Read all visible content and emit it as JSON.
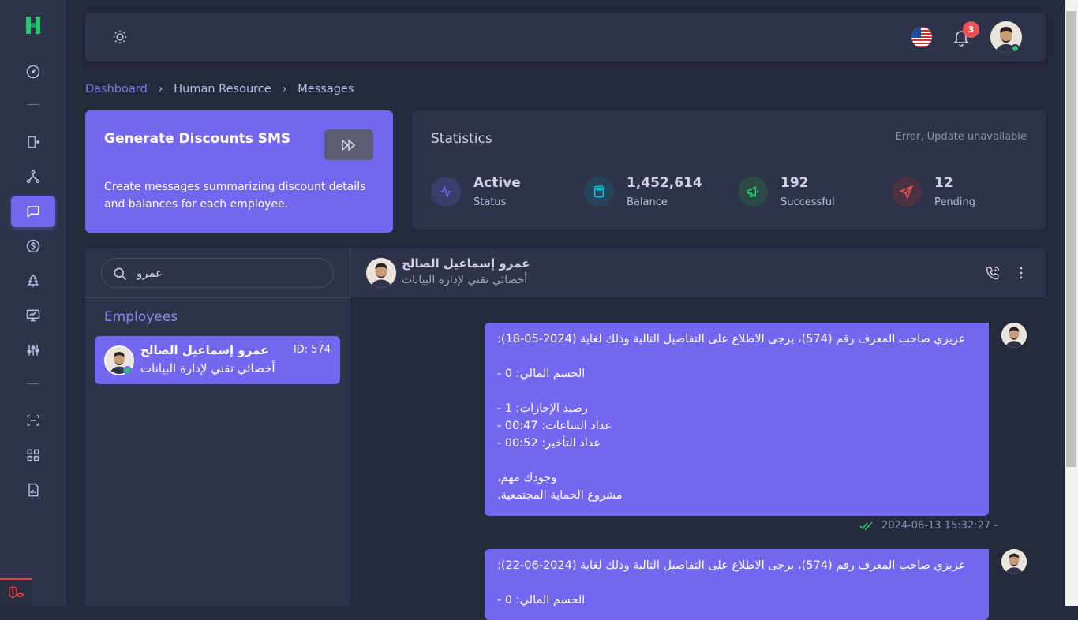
{
  "navbar": {
    "notification_count": "3"
  },
  "breadcrumb": {
    "items": [
      "Dashboard",
      "Human Resource",
      "Messages"
    ]
  },
  "generate_card": {
    "title": "Generate Discounts SMS",
    "description": "Create messages summarizing discount details and balances for each employee."
  },
  "statistics": {
    "title": "Statistics",
    "note": "Error, Update unavailable",
    "items": [
      {
        "value": "Active",
        "label": "Status",
        "icon": "activity-icon",
        "color": "#7367f0"
      },
      {
        "value": "1,452,614",
        "label": "Balance",
        "icon": "calculator-icon",
        "color": "#00cfe8"
      },
      {
        "value": "192",
        "label": "Successful",
        "icon": "speakerphone-icon",
        "color": "#28c76f"
      },
      {
        "value": "12",
        "label": "Pending",
        "icon": "send-icon",
        "color": "#ea5455"
      }
    ]
  },
  "chat": {
    "search_value": "عمرو",
    "employees_heading": "Employees",
    "employee": {
      "name": "عمرو إسماعيل الصالح",
      "role": "أخصائي تقني لإدارة البيانات",
      "id_label": "ID: 574"
    },
    "header": {
      "name": "عمرو إسماعيل الصالح",
      "role": "أخصائي تقني لإدارة البيانات"
    },
    "messages": [
      {
        "text": ":عزيزي صاحب المعرف رقم (574)، يرجى الاطلاع على التفاصيل التالية وذلك لغاية (2024-05-18)\n\n- الحسم المالي: 0\n\n- رصيد الإجازات: 1\n- عداد الساعات: 00:47\n- عداد التأخير: 00:52\n\n،وجودك مهم\n.مشروع الحماية المجتمعية",
        "timestamp": "2024-06-13 15:32:27 -"
      },
      {
        "text": ":عزيزي صاحب المعرف رقم (574)، يرجى الاطلاع على التفاصيل التالية وذلك لغاية (2024-06-22)\n\n- الحسم المالي: 0"
      }
    ]
  },
  "colors": {
    "primary": "#7367f0",
    "sidebar": "#2f3349",
    "background": "#25293c",
    "success": "#28c76f",
    "danger": "#ea5455"
  }
}
